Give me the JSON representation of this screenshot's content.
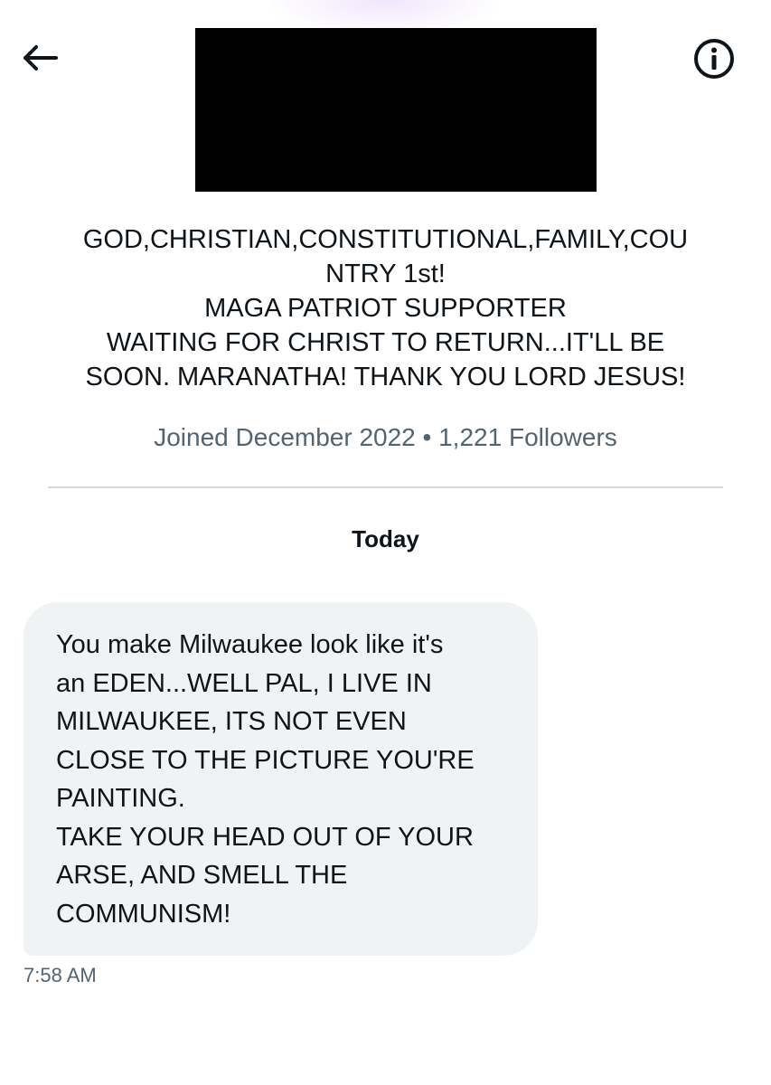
{
  "header": {
    "back_icon": "arrow-left-icon",
    "info_icon": "info-circle-icon"
  },
  "profile": {
    "bio_lines": [
      "GOD,CHRISTIAN,CONSTITUTIONAL,FAMILY,COU",
      "NTRY 1st!",
      "MAGA PATRIOT SUPPORTER",
      "WAITING FOR CHRIST TO RETURN...IT'LL BE",
      "SOON. MARANATHA! THANK YOU LORD JESUS!"
    ],
    "meta": "Joined December 2022 • 1,221 Followers"
  },
  "conversation": {
    "date_label": "Today",
    "message": {
      "lines": [
        "You make Milwaukee look like it's",
        "an EDEN...WELL PAL, I LIVE IN",
        "MILWAUKEE, ITS NOT EVEN",
        "CLOSE TO THE PICTURE YOU'RE",
        "PAINTING.",
        "TAKE YOUR HEAD OUT OF YOUR",
        "ARSE, AND SMELL THE",
        "COMMUNISM!"
      ],
      "timestamp": "7:58 AM"
    }
  },
  "colors": {
    "text_primary": "#0f1419",
    "text_secondary": "#536471",
    "bubble_background": "#eff3f4",
    "divider": "#cfd9de",
    "redaction": "#000000"
  }
}
